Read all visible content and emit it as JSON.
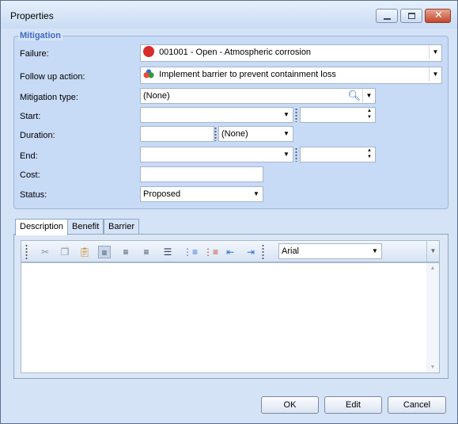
{
  "window": {
    "title": "Properties"
  },
  "group": {
    "title": "Mitigation"
  },
  "labels": {
    "failure": "Failure:",
    "follow_up": "Follow up action:",
    "mitigation_type": "Mitigation type:",
    "start": "Start:",
    "duration": "Duration:",
    "end": "End:",
    "cost": "Cost:",
    "status": "Status:"
  },
  "fields": {
    "failure": "001001 - Open - Atmospheric corrosion",
    "follow_up": "Implement barrier to prevent containment loss",
    "mitigation_type": "(None)",
    "start_date": "",
    "start_time": "",
    "duration_value": "",
    "duration_unit": "(None)",
    "end_date": "",
    "end_time": "",
    "cost": "",
    "status": "Proposed"
  },
  "tabs": [
    {
      "label": "Description"
    },
    {
      "label": "Benefit"
    },
    {
      "label": "Barrier"
    }
  ],
  "editor": {
    "font": "Arial",
    "content": ""
  },
  "buttons": {
    "ok": "OK",
    "edit": "Edit",
    "cancel": "Cancel"
  },
  "colors": {
    "accent": "#3d6cc2",
    "window_bg": "#d5e3f7"
  }
}
